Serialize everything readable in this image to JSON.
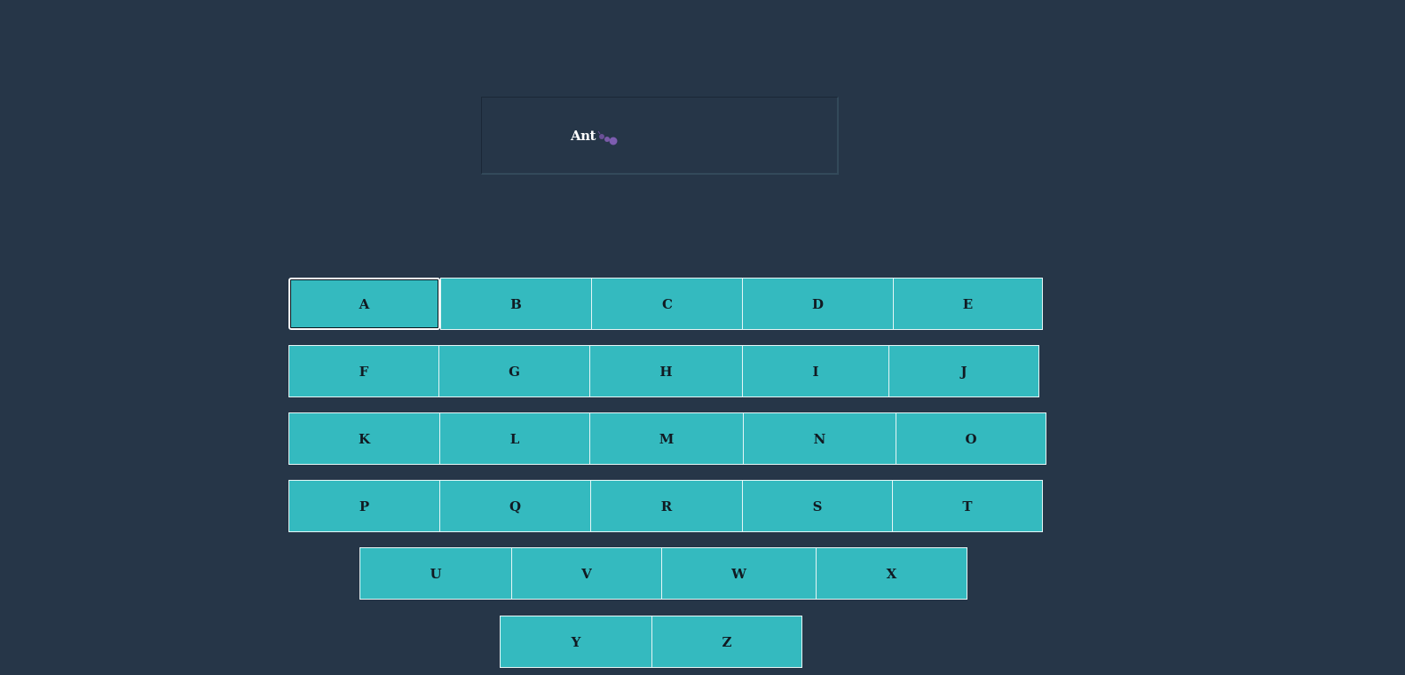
{
  "word": {
    "text": "Ant",
    "icon": "ant-icon"
  },
  "colors": {
    "background": "#263648",
    "key": "#34babf",
    "key_border": "#e6f6f6",
    "icon": "#7a5aa8"
  },
  "keyboard": {
    "selected": "A",
    "rows": [
      [
        "A",
        "B",
        "C",
        "D",
        "E"
      ],
      [
        "F",
        "G",
        "H",
        "I",
        "J"
      ],
      [
        "K",
        "L",
        "M",
        "N",
        "O"
      ],
      [
        "P",
        "Q",
        "R",
        "S",
        "T"
      ],
      [
        "U",
        "V",
        "W",
        "X"
      ],
      [
        "Y",
        "Z"
      ]
    ]
  }
}
